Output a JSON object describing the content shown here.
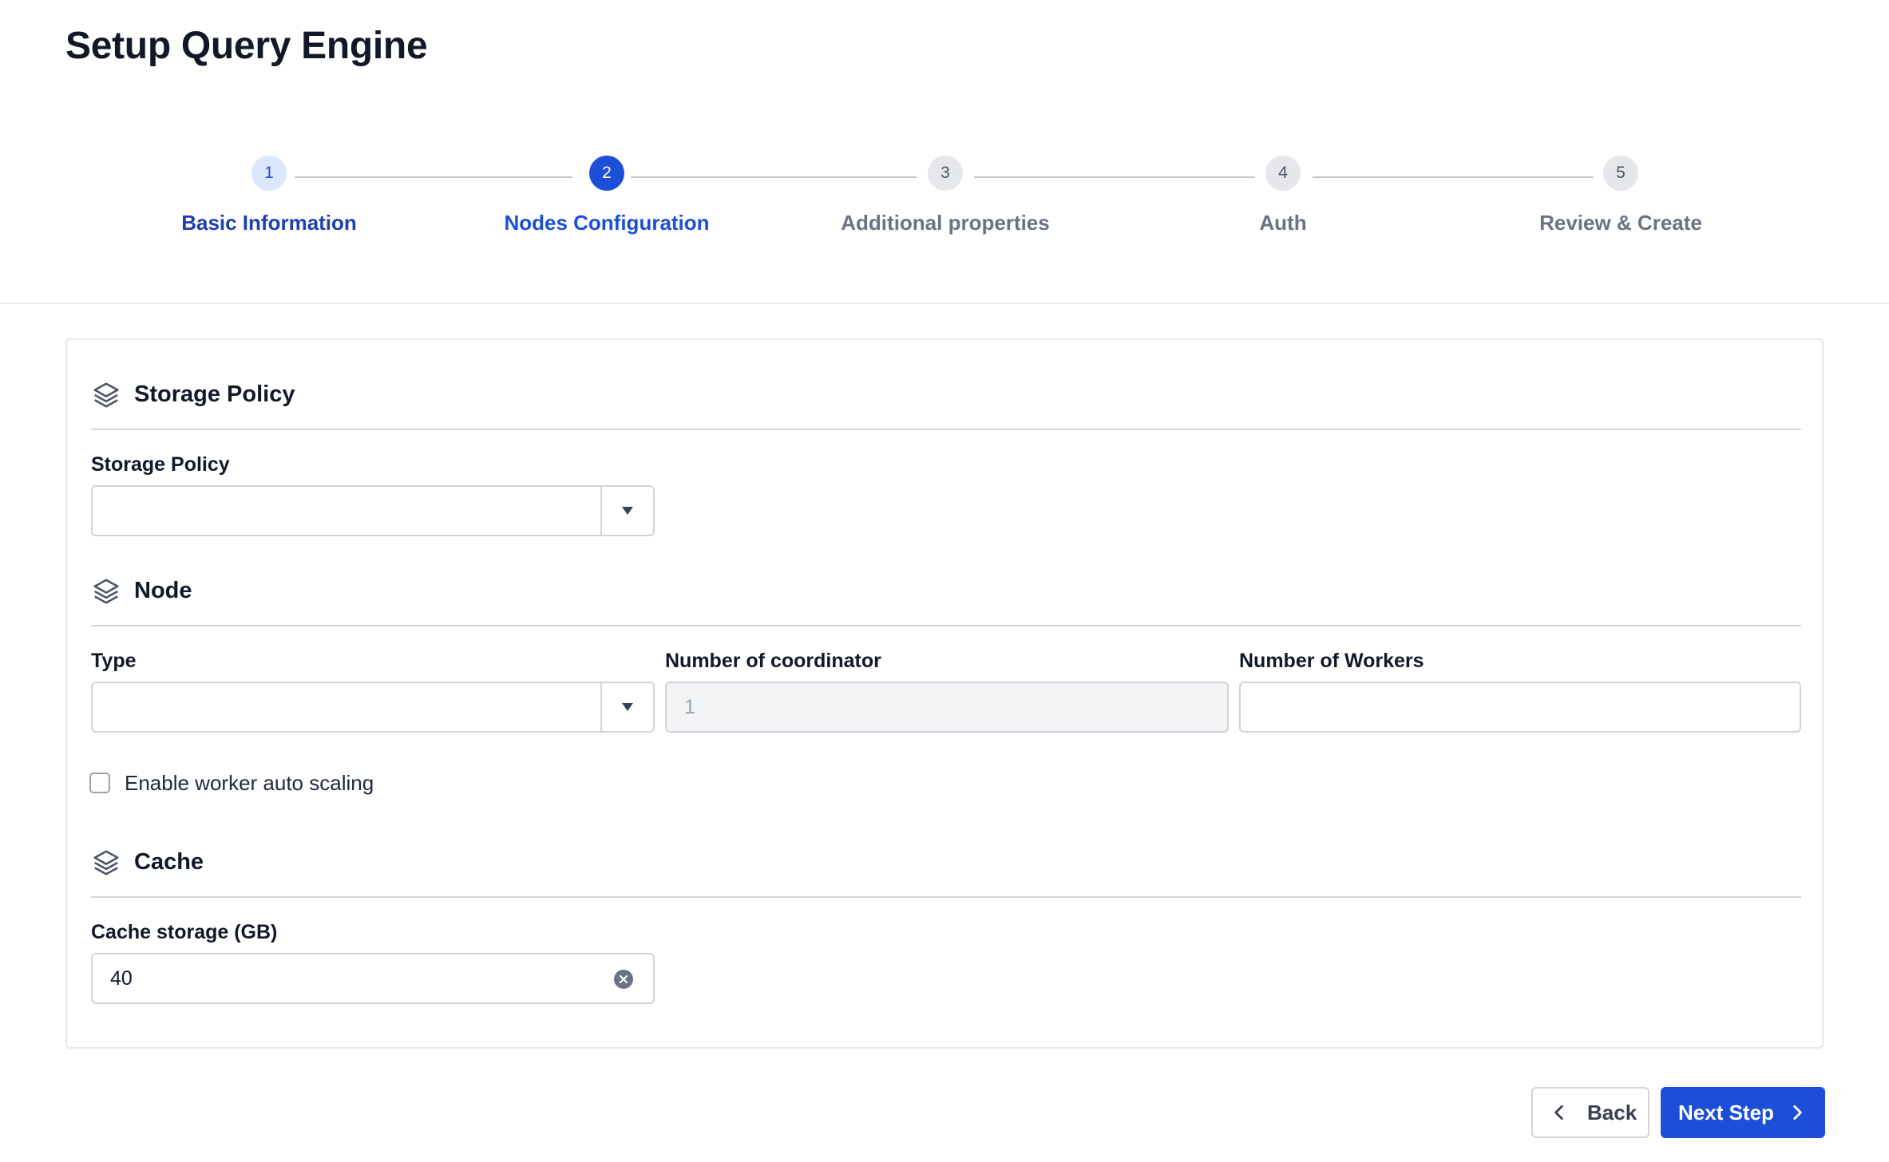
{
  "page": {
    "title": "Setup Query Engine"
  },
  "stepper": {
    "steps": [
      {
        "number": "1",
        "label": "Basic Information",
        "state": "completed"
      },
      {
        "number": "2",
        "label": "Nodes Configuration",
        "state": "active"
      },
      {
        "number": "3",
        "label": "Additional properties",
        "state": "upcoming"
      },
      {
        "number": "4",
        "label": "Auth",
        "state": "upcoming"
      },
      {
        "number": "5",
        "label": "Review & Create",
        "state": "upcoming"
      }
    ]
  },
  "storage_section": {
    "title": "Storage Policy",
    "icon": "layers-icon",
    "storage_policy": {
      "label": "Storage Policy",
      "value": ""
    }
  },
  "node_section": {
    "title": "Node",
    "icon": "layers-icon",
    "type": {
      "label": "Type",
      "value": ""
    },
    "coordinators": {
      "label": "Number of coordinator",
      "value": "1",
      "disabled": true
    },
    "workers": {
      "label": "Number of Workers",
      "value": ""
    },
    "auto_scaling": {
      "label": "Enable worker auto scaling",
      "checked": false
    }
  },
  "cache_section": {
    "title": "Cache",
    "icon": "layers-icon",
    "cache_storage": {
      "label": "Cache storage (GB)",
      "value": "40"
    }
  },
  "footer": {
    "back_label": "Back",
    "next_label": "Next Step"
  },
  "colors": {
    "primary": "#1d4ed8",
    "completed_step_bg": "#dbe7fc",
    "upcoming_step_bg": "#e5e7eb",
    "border": "#d1d5db"
  }
}
